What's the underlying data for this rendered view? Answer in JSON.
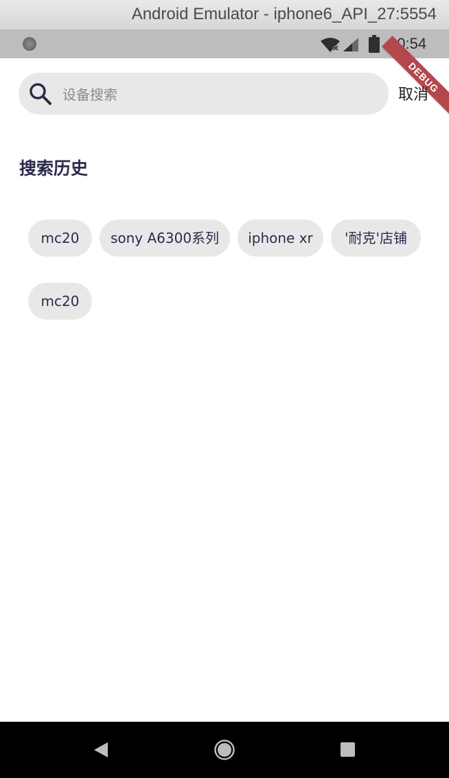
{
  "window": {
    "title": "Android Emulator - iphone6_API_27:5554"
  },
  "status_bar": {
    "time": "10:54",
    "debug_label": "DEBUG",
    "icons": [
      "wifi-no-internet-icon",
      "signal-icon",
      "battery-icon"
    ]
  },
  "search": {
    "placeholder": "设备搜索",
    "value": "",
    "icon": "search-icon",
    "cancel_label": "取消"
  },
  "history": {
    "title": "搜索历史",
    "items": [
      {
        "label": "mc20"
      },
      {
        "label": "sony A6300系列"
      },
      {
        "label": "iphone xr"
      },
      {
        "label": "'耐克'店铺"
      },
      {
        "label": "mc20"
      }
    ]
  },
  "nav_bar": {
    "icons": [
      "back-icon",
      "home-icon",
      "recents-icon"
    ]
  },
  "colors": {
    "text_primary": "#2b2a4c",
    "chip_bg": "#e8e8e8",
    "debug_ribbon": "#b4474b",
    "status_bar_bg": "#bdbdbd"
  }
}
